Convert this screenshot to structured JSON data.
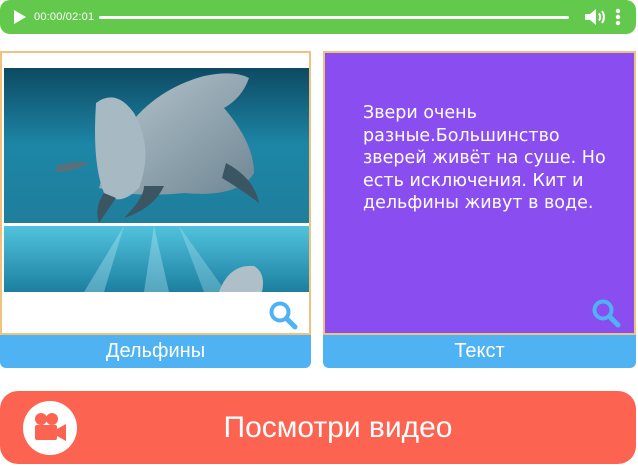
{
  "player": {
    "time": "00:00/02:01",
    "icons": {
      "play": "play-icon",
      "volume": "volume-icon",
      "more": "more-vertical-icon"
    },
    "colors": {
      "bar": "#63c94c"
    }
  },
  "cards": [
    {
      "label": "Дельфины",
      "image": "dolphins-photo",
      "icon": "magnifier-icon"
    },
    {
      "label": "Текст",
      "text": "Звери очень разные.Большинство зверей живёт на суше. Но есть исключения. Кит и дельфины живут в воде.",
      "icon": "magnifier-icon",
      "colors": {
        "background": "#8a4ef0"
      }
    }
  ],
  "video_button": {
    "label": "Посмотри видео",
    "icon": "video-camera-icon",
    "colors": {
      "background": "#fc6350"
    }
  },
  "colors": {
    "label_bar": "#4fb2f2",
    "card_border": "#f1c27e",
    "zoom": "#4fb2f2"
  }
}
